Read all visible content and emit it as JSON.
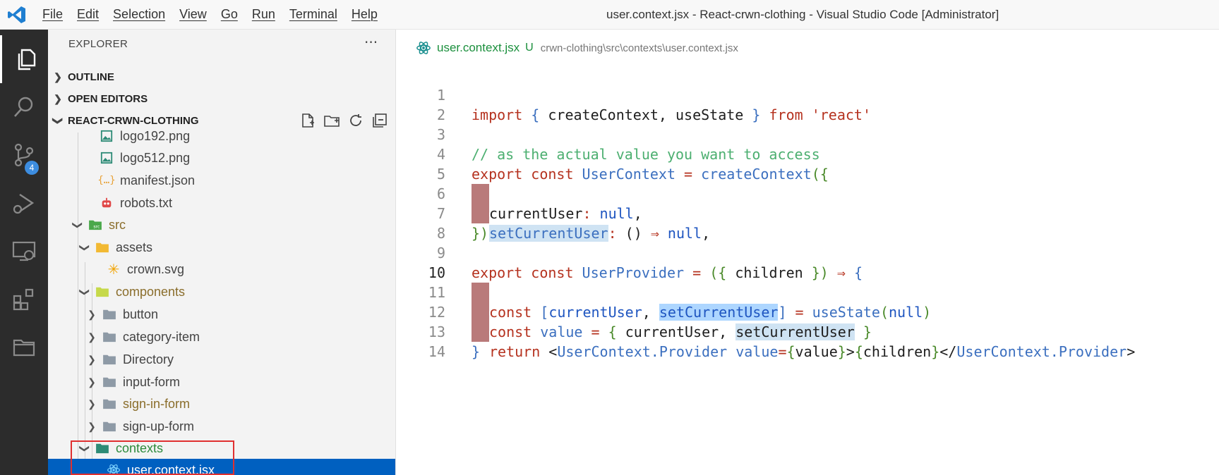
{
  "titlebar": {
    "menu": [
      "File",
      "Edit",
      "Selection",
      "View",
      "Go",
      "Run",
      "Terminal",
      "Help"
    ],
    "window_title": "user.context.jsx - React-crwn-clothing - Visual Studio Code [Administrator]"
  },
  "activity_bar": {
    "items": [
      "explorer-icon",
      "search-icon",
      "source-control-icon",
      "run-debug-icon",
      "remote-explorer-icon",
      "extensions-icon",
      "folder-icon"
    ],
    "source_control_badge": "4"
  },
  "sidebar": {
    "title": "EXPLORER",
    "more": "···",
    "sections": {
      "outline": "OUTLINE",
      "open_editors": "OPEN EDITORS",
      "project": "REACT-CRWN-CLOTHING"
    },
    "tree": [
      {
        "label": "logo192.png",
        "icon": "image-icon"
      },
      {
        "label": "logo512.png",
        "icon": "image-icon"
      },
      {
        "label": "manifest.json",
        "icon": "json-icon"
      },
      {
        "label": "robots.txt",
        "icon": "robot-icon"
      },
      {
        "label": "src",
        "icon": "folder-src-icon",
        "expanded": true,
        "status": "modified"
      },
      {
        "label": "assets",
        "icon": "folder-assets-icon",
        "expanded": true
      },
      {
        "label": "crown.svg",
        "icon": "svg-icon"
      },
      {
        "label": "components",
        "icon": "folder-components-icon",
        "expanded": true,
        "status": "modified"
      },
      {
        "label": "button",
        "icon": "folder-icon",
        "expanded": false
      },
      {
        "label": "category-item",
        "icon": "folder-icon",
        "expanded": false
      },
      {
        "label": "Directory",
        "icon": "folder-icon",
        "expanded": false
      },
      {
        "label": "input-form",
        "icon": "folder-icon",
        "expanded": false
      },
      {
        "label": "sign-in-form",
        "icon": "folder-icon",
        "expanded": false,
        "status": "modified"
      },
      {
        "label": "sign-up-form",
        "icon": "folder-icon",
        "expanded": false
      },
      {
        "label": "contexts",
        "icon": "folder-contexts-icon",
        "expanded": true,
        "status": "untracked"
      },
      {
        "label": "user.context.jsx",
        "icon": "react-icon",
        "selected": true,
        "git": "U"
      }
    ]
  },
  "editor": {
    "breadcrumb": {
      "file": "user.context.jsx",
      "git": "U",
      "path": "crwn-clothing\\src\\contexts\\user.context.jsx"
    },
    "current_line": "10",
    "line_numbers": [
      "1",
      "2",
      "3",
      "4",
      "5",
      "6",
      "7",
      "8",
      "9",
      "10",
      "11",
      "12",
      "13",
      "14"
    ]
  },
  "colors": {
    "accent": "#0060c0",
    "modified_dot": "#c9a96b",
    "untracked_dot": "#6ab04c",
    "highlight_border": "#e03030"
  }
}
